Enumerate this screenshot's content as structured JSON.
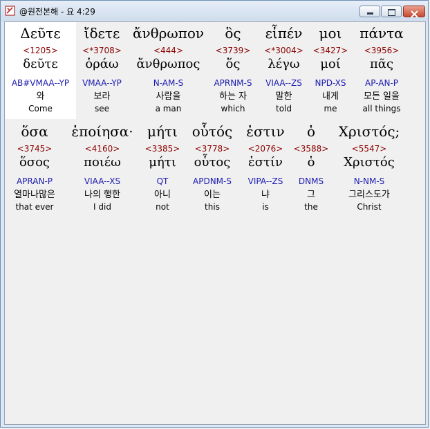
{
  "window": {
    "title": "@원전본해 - 요 4:29"
  },
  "rows": [
    [
      {
        "greek": "Δεῦτε",
        "strong": "<1205>",
        "lemma": "δεῦτε",
        "parsing": "AB#VMAA--YP",
        "korean": "와",
        "english": "Come",
        "selected": true
      },
      {
        "greek": "ἴδετε",
        "strong": "<*3708>",
        "lemma": "ὁράω",
        "parsing": "VMAA--YP",
        "korean": "보라",
        "english": "see"
      },
      {
        "greek": "ἄνθρωπον",
        "strong": "<444>",
        "lemma": "ἄνθρωπος",
        "parsing": "N-AM-S",
        "korean": "사람을",
        "english": "a man"
      },
      {
        "greek": "ὃς",
        "strong": "<3739>",
        "lemma": "ὅς",
        "parsing": "APRNM-S",
        "korean": "하는 자",
        "english": "which"
      },
      {
        "greek": "εἶπέν",
        "strong": "<*3004>",
        "lemma": "λέγω",
        "parsing": "VIAA--ZS",
        "korean": "말한",
        "english": "told"
      },
      {
        "greek": "μοι",
        "strong": "<3427>",
        "lemma": "μοί",
        "parsing": "NPD-XS",
        "korean": "내게",
        "english": "me"
      },
      {
        "greek": "πάντα",
        "strong": "<3956>",
        "lemma": "πᾶς",
        "parsing": "AP-AN-P",
        "korean": "모든 일을",
        "english": "all things"
      }
    ],
    [
      {
        "greek": "ὅσα",
        "strong": "<3745>",
        "lemma": "ὅσος",
        "parsing": "APRAN-P",
        "korean": "열마나많은",
        "english": "that ever"
      },
      {
        "greek": "ἐποίησα·",
        "strong": "<4160>",
        "lemma": "ποιέω",
        "parsing": "VIAA--XS",
        "korean": "나의 행한",
        "english": "I did"
      },
      {
        "greek": "μήτι",
        "strong": "<3385>",
        "lemma": "μήτι",
        "parsing": "QT",
        "korean": "아니",
        "english": "not"
      },
      {
        "greek": "οὗτός",
        "strong": "<3778>",
        "lemma": "οὗτος",
        "parsing": "APDNM-S",
        "korean": "이는",
        "english": "this"
      },
      {
        "greek": "ἐστιν",
        "strong": "<2076>",
        "lemma": "ἐστίν",
        "parsing": "VIPA--ZS",
        "korean": "냐",
        "english": "is"
      },
      {
        "greek": "ὁ",
        "strong": "<3588>",
        "lemma": "ὁ",
        "parsing": "DNMS",
        "korean": "그",
        "english": "the"
      },
      {
        "greek": "Χριστός;",
        "strong": "<5547>",
        "lemma": "Χριστός",
        "parsing": "N-NM-S",
        "korean": "그리스도가",
        "english": "Christ"
      }
    ]
  ]
}
